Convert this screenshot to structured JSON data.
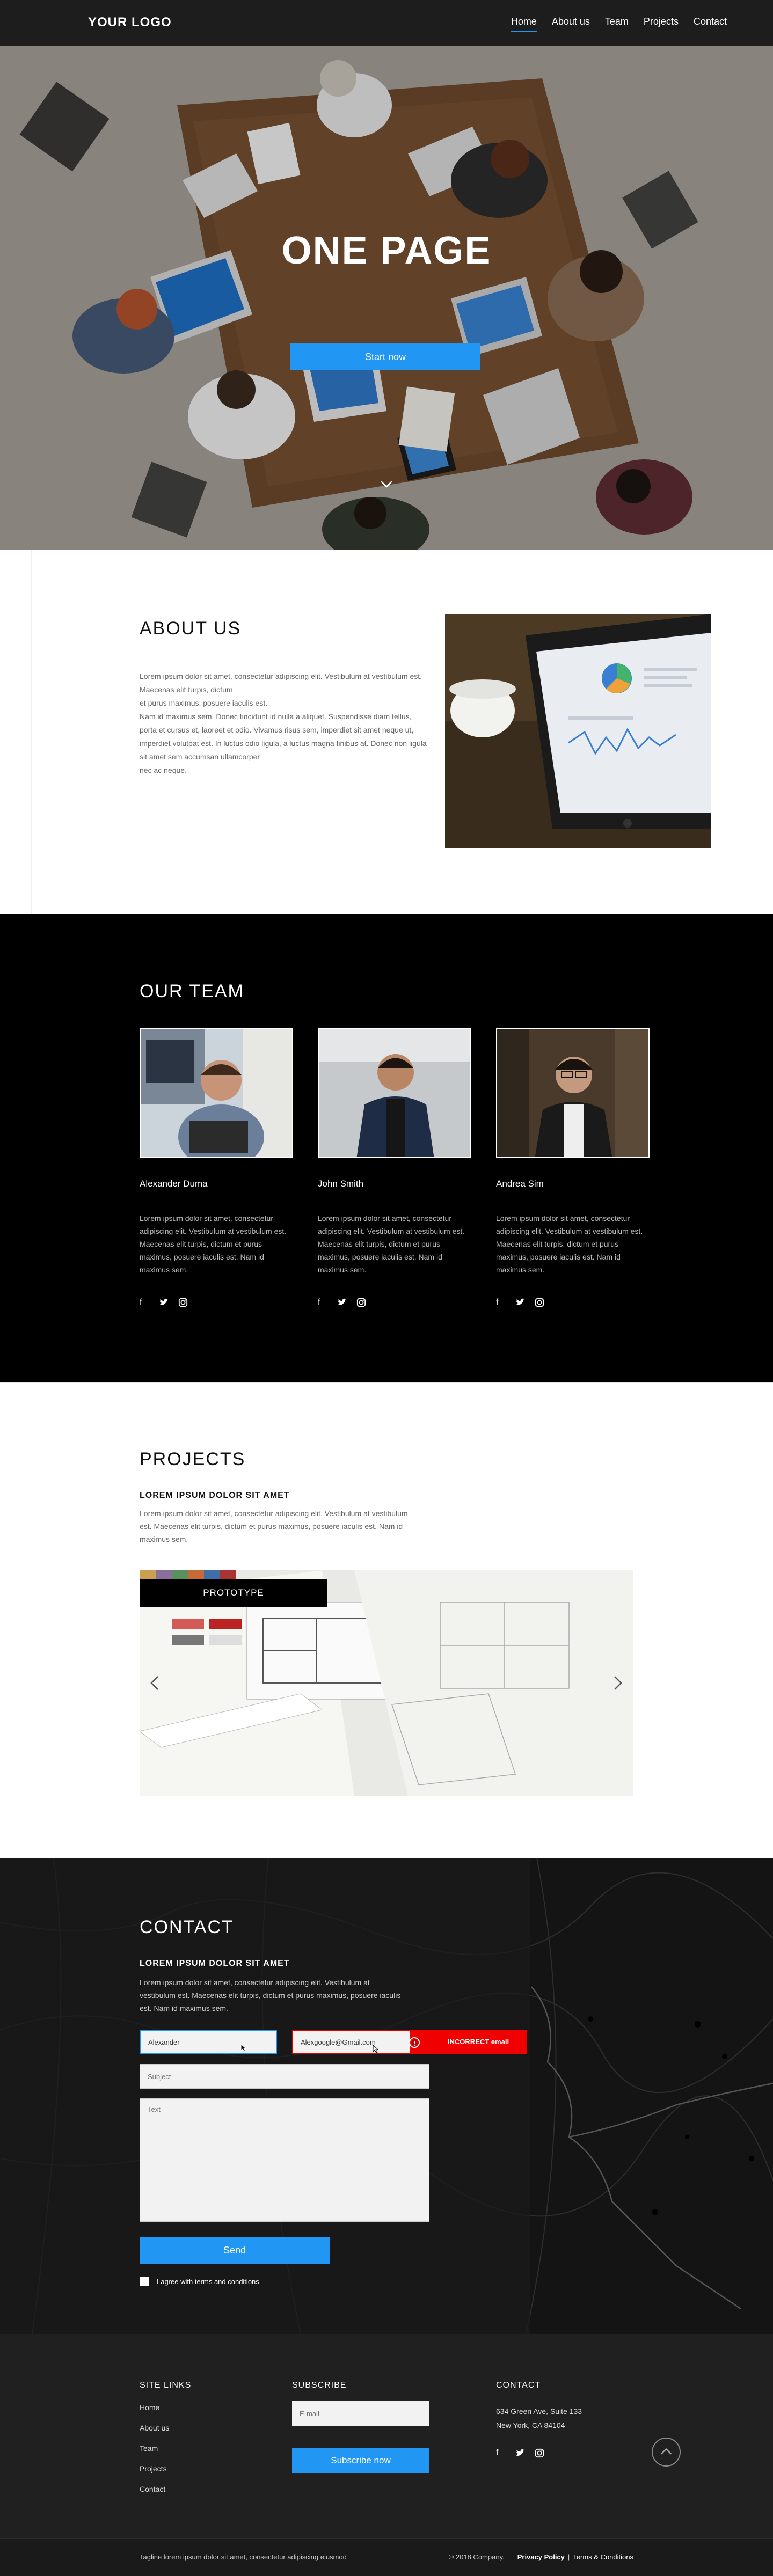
{
  "header": {
    "logo": "YOUR LOGO",
    "nav": [
      {
        "label": "Home",
        "active": true
      },
      {
        "label": "About us",
        "active": false
      },
      {
        "label": "Team",
        "active": false
      },
      {
        "label": "Projects",
        "active": false
      },
      {
        "label": "Contact",
        "active": false
      }
    ]
  },
  "hero": {
    "title": "ONE PAGE",
    "button": "Start now",
    "scroll_icon": "chevron-down-icon"
  },
  "about": {
    "title": "ABOUT US",
    "text": "Lorem ipsum dolor sit amet, consectetur adipiscing elit. Vestibulum at vestibulum est. Maecenas elit turpis, dictum\net purus maximus, posuere iaculis est.\nNam id maximus sem. Donec tincidunt id nulla a aliquet. Suspendisse diam tellus, porta et cursus et, laoreet et odio. Vivamus risus sem, imperdiet sit amet neque ut, imperdiet volutpat est. In luctus odio ligula, a luctus magna finibus at. Donec non ligula sit amet sem accumsan ullamcorper\nnec ac neque."
  },
  "team": {
    "title": "OUR TEAM",
    "members": [
      {
        "name": "Alexander Duma",
        "bio": "Lorem ipsum dolor sit amet, consectetur adipiscing elit. Vestibulum at vestibulum est. Maecenas elit turpis, dictum et purus maximus, posuere iaculis est. Nam id maximus sem."
      },
      {
        "name": "John Smith",
        "bio": "Lorem ipsum dolor sit amet, consectetur adipiscing elit. Vestibulum at vestibulum est. Maecenas elit turpis, dictum et purus maximus, posuere iaculis est. Nam id maximus sem."
      },
      {
        "name": "Andrea Sim",
        "bio": "Lorem ipsum dolor sit amet, consectetur adipiscing elit. Vestibulum at vestibulum est. Maecenas elit turpis, dictum et purus maximus, posuere iaculis est. Nam id maximus sem."
      }
    ],
    "social_icons": [
      "facebook-icon",
      "twitter-icon",
      "instagram-icon"
    ]
  },
  "projects": {
    "title": "PROJECTS",
    "subtitle": "LOREM IPSUM DOLOR SIT AMET",
    "text": "Lorem ipsum dolor sit amet, consectetur adipiscing elit. Vestibulum at vestibulum est. Maecenas elit turpis, dictum et purus maximus, posuere iaculis est. Nam id maximus sem.",
    "badge": "PROTOTYPE"
  },
  "contact": {
    "title": "CONTACT",
    "subtitle": "LOREM IPSUM DOLOR SIT AMET",
    "text": "Lorem ipsum dolor sit amet, consectetur adipiscing elit. Vestibulum at vestibulum est. Maecenas elit turpis, dictum et purus maximus, posuere iaculis est. Nam id maximus sem.",
    "name_value": "Alexander",
    "email_value": "Alexgoogle@Gmail.com",
    "email_error": "INCORRECT email",
    "subject_placeholder": "Subject",
    "text_placeholder": "Text",
    "send": "Send",
    "agree_prefix": "I agree with",
    "agree_link": "terms and conditions"
  },
  "footer": {
    "site_links_title": "SITE LINKS",
    "links": [
      "Home",
      "About us",
      "Team",
      "Projects",
      "Contact"
    ],
    "subscribe_title": "SUBSCRIBE",
    "email_placeholder": "E-mail",
    "subscribe_button": "Subscribe now",
    "contact_title": "CONTACT",
    "address_line1": "634 Green Ave, Suite 133",
    "address_line2": "New York, CA 84104",
    "tagline": "Tagline lorem ipsum dolor sit amet, consectetur adipiscing eiusmod",
    "copyright": "© 2018 Company.",
    "privacy": "Privacy Policy",
    "separator": "|",
    "terms": "Terms & Conditions"
  },
  "colors": {
    "accent": "#2196f3",
    "error": "#f00000",
    "dark": "#000000",
    "footer": "#202020"
  }
}
